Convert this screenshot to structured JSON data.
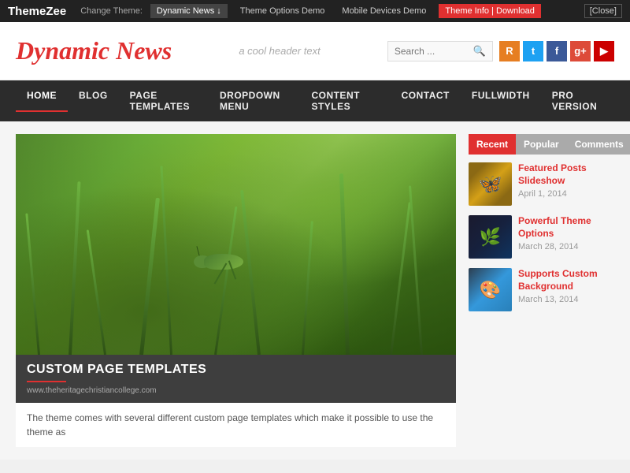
{
  "topbar": {
    "logo": "ThemeZee",
    "change_theme_label": "Change Theme:",
    "active_theme": "Dynamic News ↓",
    "links": [
      {
        "label": "Theme Options Demo",
        "id": "theme-options-link"
      },
      {
        "label": "Mobile Devices Demo",
        "id": "mobile-devices-link"
      },
      {
        "label": "Theme Info | Download",
        "id": "theme-info-link"
      },
      {
        "label": "[Close]",
        "id": "close-link"
      }
    ]
  },
  "header": {
    "site_title": "Dynamic News",
    "tagline": "a cool header text",
    "search_placeholder": "Search ..."
  },
  "social_icons": [
    {
      "name": "rss",
      "symbol": "R",
      "class": "social-rss"
    },
    {
      "name": "twitter",
      "symbol": "t",
      "class": "social-twitter"
    },
    {
      "name": "facebook",
      "symbol": "f",
      "class": "social-facebook"
    },
    {
      "name": "googleplus",
      "symbol": "g+",
      "class": "social-gplus"
    },
    {
      "name": "youtube",
      "symbol": "▶",
      "class": "social-youtube"
    }
  ],
  "nav": {
    "items": [
      {
        "label": "HOME",
        "active": true
      },
      {
        "label": "BLOG",
        "active": false
      },
      {
        "label": "PAGE TEMPLATES",
        "active": false
      },
      {
        "label": "DROPDOWN MENU",
        "active": false
      },
      {
        "label": "CONTENT STYLES",
        "active": false
      },
      {
        "label": "CONTACT",
        "active": false
      },
      {
        "label": "FULLWIDTH",
        "active": false
      },
      {
        "label": "PRO VERSION",
        "active": false
      }
    ]
  },
  "main_post": {
    "title": "CUSTOM PAGE TEMPLATES",
    "watermark": "www.theheritagechristiancollege.com",
    "excerpt": "The theme comes with several different custom page templates which make it possible to use the theme as"
  },
  "sidebar": {
    "tabs": [
      {
        "label": "Recent",
        "active": true
      },
      {
        "label": "Popular",
        "active": false
      },
      {
        "label": "Comments",
        "active": false
      }
    ],
    "posts": [
      {
        "title": "Featured Posts Slideshow",
        "date": "April 1, 2014",
        "thumb_type": "butterfly"
      },
      {
        "title": "Powerful Theme Options",
        "date": "March 28, 2014",
        "thumb_type": "dark"
      },
      {
        "title": "Supports Custom Background",
        "date": "March 13, 2014",
        "thumb_type": "blue"
      }
    ]
  }
}
